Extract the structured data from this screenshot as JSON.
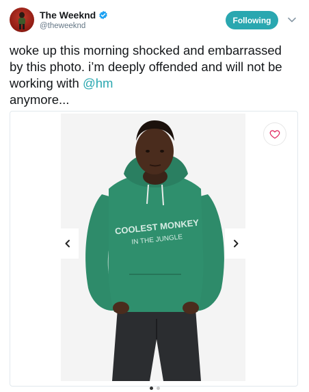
{
  "user": {
    "display_name": "The Weeknd",
    "handle": "@theweeknd",
    "verified": true
  },
  "follow_button": {
    "label": "Following"
  },
  "tweet": {
    "text_before_mention": "woke up this morning shocked and embarrassed by this photo. i’m deeply offended and will not be working with ",
    "mention": "@hm",
    "text_after_mention": " anymore..."
  },
  "media": {
    "hoodie_print_line1": "COOLEST MONKEY",
    "hoodie_print_line2": "IN THE JUNGLE",
    "carousel_pages": 2,
    "carousel_current": 1
  },
  "icons": {
    "verified": "verified-badge-icon",
    "menu": "chevron-down-icon",
    "favorite": "heart-icon",
    "prev": "chevron-left-icon",
    "next": "chevron-right-icon"
  },
  "colors": {
    "accent": "#2aa7b0",
    "verified": "#1da1f2",
    "hoodie": "#2e8b6a",
    "heart": "#e0245e"
  }
}
